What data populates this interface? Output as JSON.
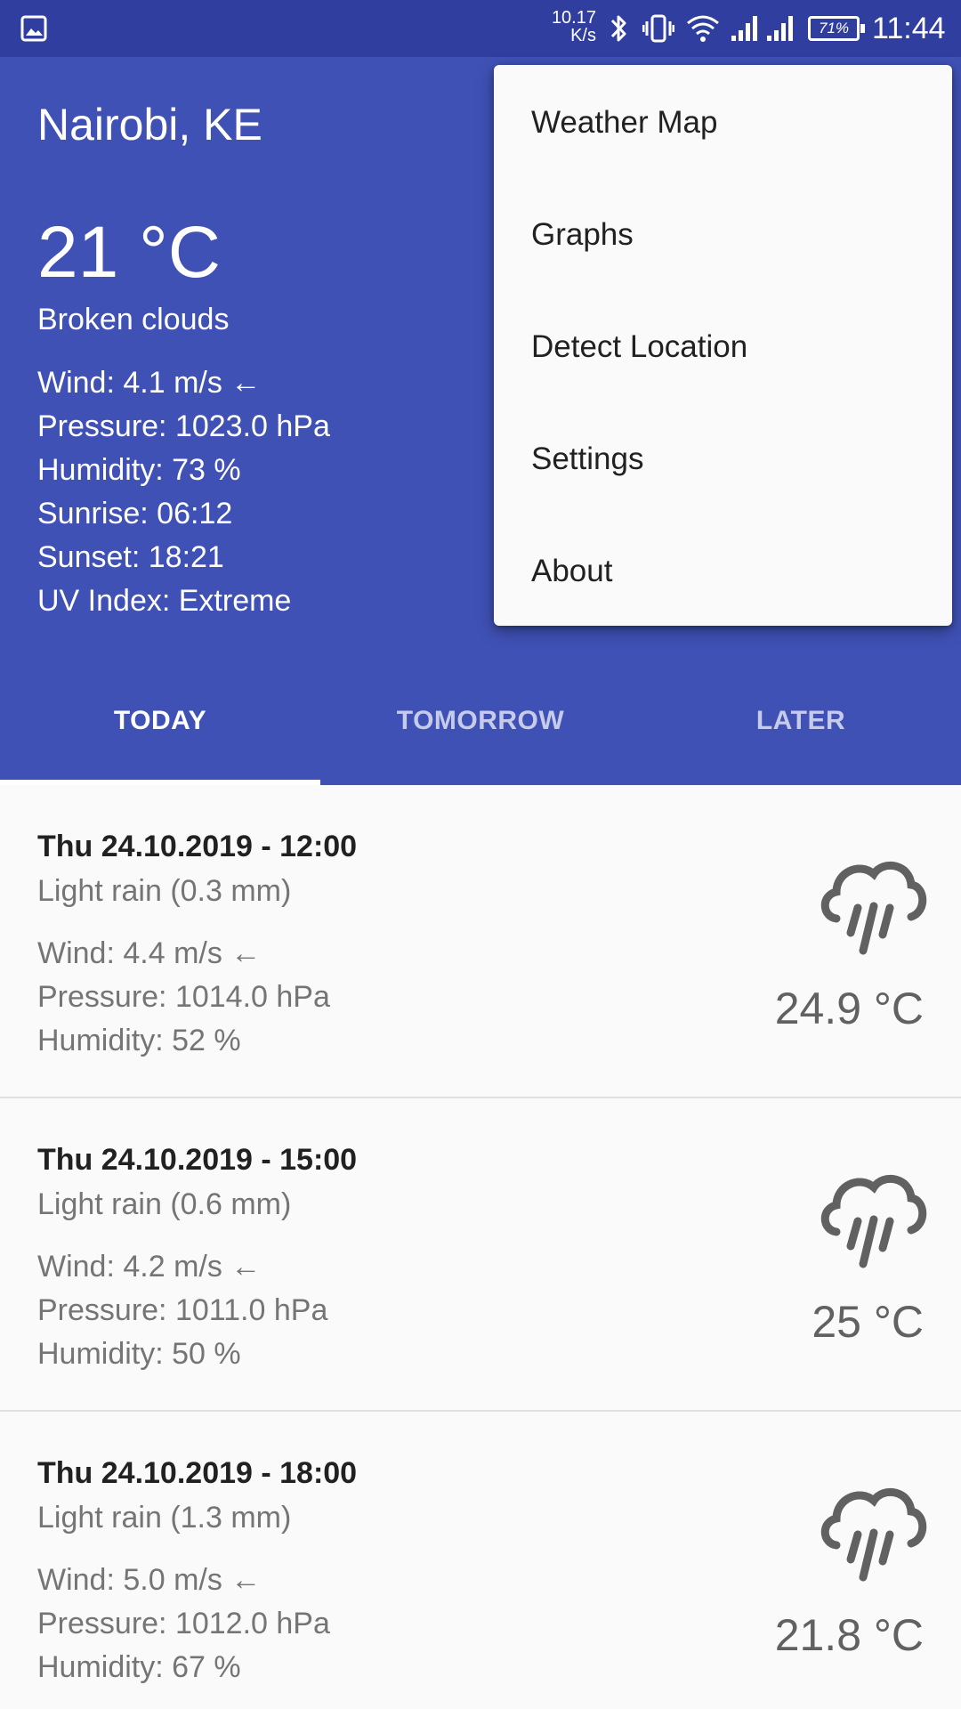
{
  "status_bar": {
    "net_speed_value": "10.17",
    "net_speed_unit": "K/s",
    "battery": "71%",
    "time": "11:44",
    "icons": [
      "gallery-icon",
      "bluetooth-icon",
      "vibrate-icon",
      "wifi-icon",
      "signal-icon",
      "signal-icon",
      "battery-icon"
    ]
  },
  "header": {
    "city": "Nairobi, KE",
    "temperature": "21 °C",
    "description": "Broken clouds",
    "details": {
      "wind": "Wind: 4.1 m/s ←",
      "pressure": "Pressure: 1023.0 hPa",
      "humidity": "Humidity: 73 %",
      "sunrise": "Sunrise: 06:12",
      "sunset": "Sunset: 18:21",
      "uv": "UV Index: Extreme"
    },
    "background_color": "#3f51b5"
  },
  "tabs": [
    {
      "label": "TODAY",
      "active": true
    },
    {
      "label": "TOMORROW",
      "active": false
    },
    {
      "label": "LATER",
      "active": false
    }
  ],
  "forecast": [
    {
      "time": "Thu 24.10.2019 - 12:00",
      "condition": "Light rain (0.3 mm)",
      "wind": "Wind: 4.4 m/s ←",
      "pressure": "Pressure: 1014.0 hPa",
      "humidity": "Humidity: 52 %",
      "temperature": "24.9 °C",
      "icon": "rain-cloud-icon"
    },
    {
      "time": "Thu 24.10.2019 - 15:00",
      "condition": "Light rain (0.6 mm)",
      "wind": "Wind: 4.2 m/s ←",
      "pressure": "Pressure: 1011.0 hPa",
      "humidity": "Humidity: 50 %",
      "temperature": "25 °C",
      "icon": "rain-cloud-icon"
    },
    {
      "time": "Thu 24.10.2019 - 18:00",
      "condition": "Light rain (1.3 mm)",
      "wind": "Wind: 5.0 m/s ←",
      "pressure": "Pressure: 1012.0 hPa",
      "humidity": "Humidity: 67 %",
      "temperature": "21.8 °C",
      "icon": "rain-cloud-icon"
    }
  ],
  "menu": {
    "items": [
      "Weather Map",
      "Graphs",
      "Detect Location",
      "Settings",
      "About"
    ]
  },
  "colors": {
    "status_bar": "#303f9f",
    "primary": "#3f51b5",
    "text_primary": "#212121",
    "text_secondary": "#757575"
  }
}
